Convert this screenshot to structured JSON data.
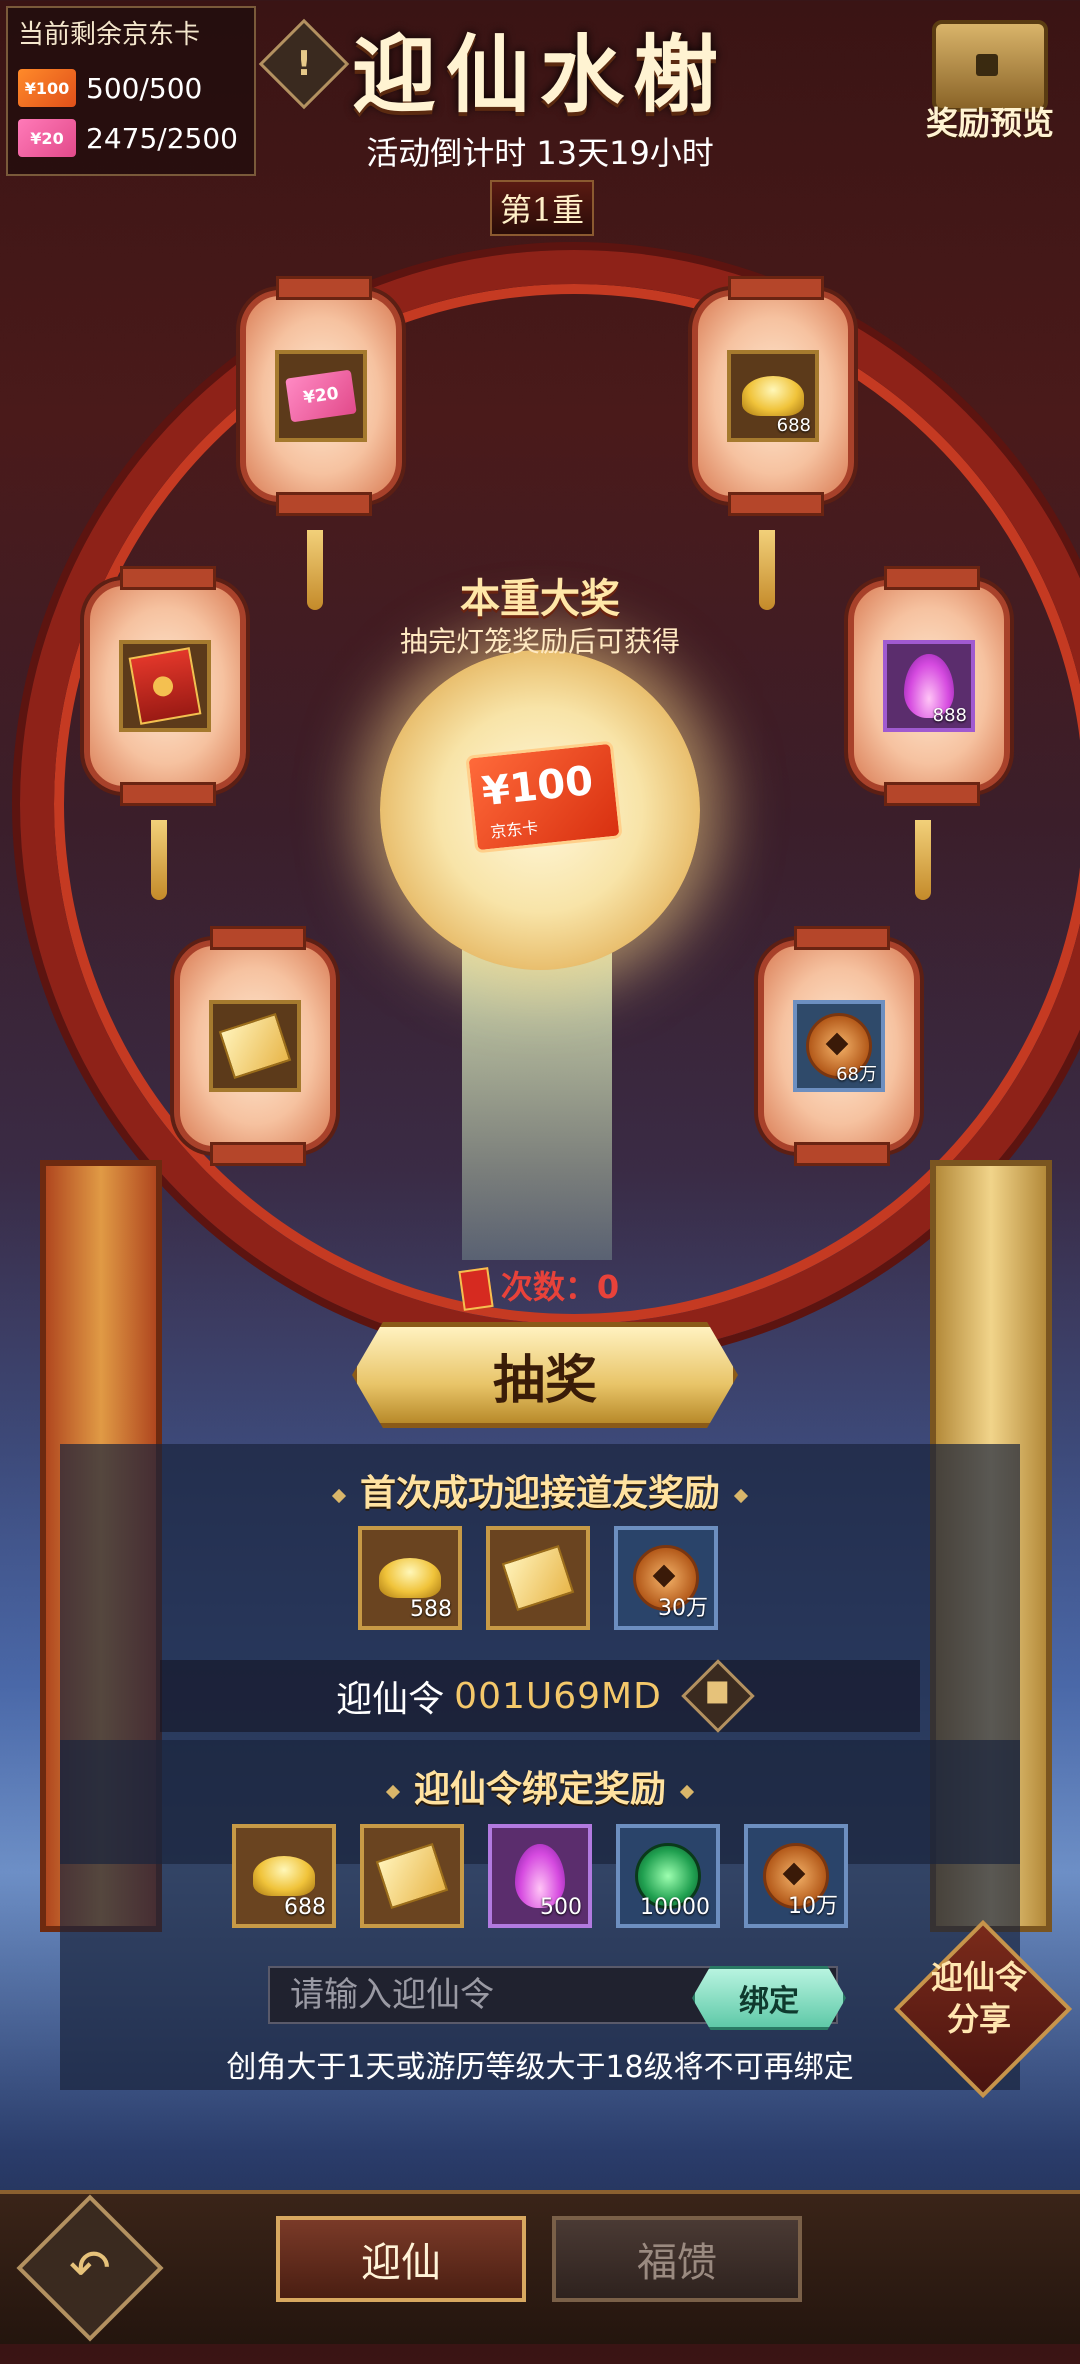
{
  "header": {
    "title": "迎仙水榭",
    "countdown": "活动倒计时 13天19小时",
    "tier": "第1重",
    "exclaim_icon": "!",
    "chest_label": "奖励预览"
  },
  "card_status": {
    "title": "当前剩余京东卡",
    "rows": [
      {
        "card_label": "¥100",
        "value": "500/500"
      },
      {
        "card_label": "¥20",
        "value": "2475/2500"
      }
    ]
  },
  "lanterns": [
    {
      "item": "pink-card-icon",
      "label": "¥20",
      "qty": ""
    },
    {
      "item": "gold-ingot-icon",
      "label": "",
      "qty": "688"
    },
    {
      "item": "red-envelope-icon",
      "label": "",
      "qty": ""
    },
    {
      "item": "purple-flame-icon",
      "label": "",
      "qty": "888"
    },
    {
      "item": "gold-paper-icon",
      "label": "",
      "qty": ""
    },
    {
      "item": "copper-coin-icon",
      "label": "",
      "qty": "68万"
    }
  ],
  "grand_prize": {
    "title": "本重大奖",
    "subtitle": "抽完灯笼奖励后可获得",
    "card_value": "¥100",
    "card_name": "京东卡"
  },
  "draw": {
    "count_text": "次数：0",
    "button_label": "抽奖"
  },
  "first_reward": {
    "title": "首次成功迎接道友奖励",
    "items": [
      {
        "icon": "gold-ingot-icon",
        "qty": "588"
      },
      {
        "icon": "gold-paper-icon",
        "qty": ""
      },
      {
        "icon": "copper-coin-icon",
        "qty": "30万"
      }
    ]
  },
  "code": {
    "label": "迎仙令",
    "value": "001U69MD"
  },
  "bind_reward": {
    "title": "迎仙令绑定奖励",
    "items": [
      {
        "icon": "gold-ingot-icon",
        "qty": "688"
      },
      {
        "icon": "gold-paper-icon",
        "qty": ""
      },
      {
        "icon": "purple-flame-icon",
        "qty": "500"
      },
      {
        "icon": "jade-orb-icon",
        "qty": "10000"
      },
      {
        "icon": "copper-coin-icon",
        "qty": "10万"
      }
    ]
  },
  "bind": {
    "placeholder": "请输入迎仙令",
    "button_label": "绑定",
    "note": "创角大于1天或游历等级大于18级将不可再绑定"
  },
  "share": {
    "label_line1": "迎仙令",
    "label_line2": "分享"
  },
  "bottom_tabs": {
    "back_icon": "↶",
    "active": "迎仙",
    "inactive": "福馈"
  }
}
